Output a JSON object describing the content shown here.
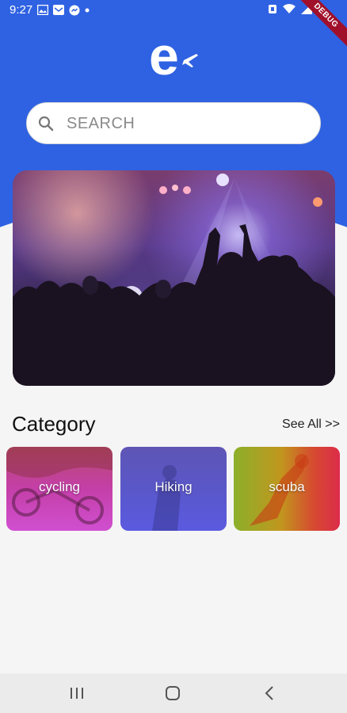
{
  "status_bar": {
    "time": "9:27",
    "left_icons": [
      "image-icon",
      "mail-icon",
      "messenger-icon",
      "dot-icon"
    ],
    "right_icons": [
      "alarm-icon",
      "wifi-icon",
      "signal-icon",
      "battery-icon"
    ],
    "debug_banner": "DEBUG"
  },
  "header": {
    "logo_letter": "e",
    "logo_icon": "airplane-icon",
    "background_color": "#2f62e2"
  },
  "search": {
    "placeholder": "SEARCH",
    "icon": "search-icon"
  },
  "hero": {
    "image_icon": "concert-photo"
  },
  "category": {
    "title": "Category",
    "see_all": "See All >>",
    "items": [
      {
        "label": "cycling"
      },
      {
        "label": "Hiking"
      },
      {
        "label": "scuba"
      }
    ]
  },
  "nav_bar": {
    "buttons": [
      "recents-icon",
      "home-icon",
      "back-icon"
    ]
  }
}
